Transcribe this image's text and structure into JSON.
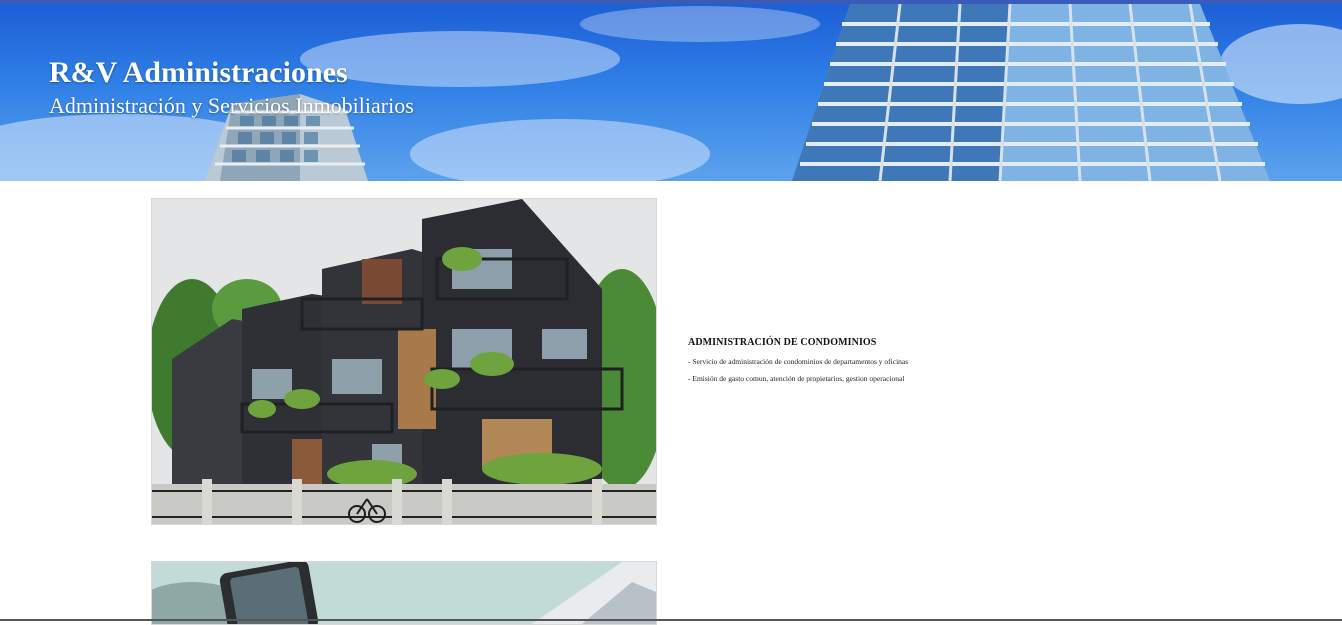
{
  "header": {
    "title": "R&V Administraciones",
    "subtitle": "Administración y Servicios Inmobiliarios"
  },
  "services": [
    {
      "heading": "ADMINISTRACIÓN DE CONDOMINIOS",
      "items": [
        "- Servicio de administración de condominios de departamentos y oficinas",
        "- Emisión de gasto comun, atención de propietarios, gestion operacional"
      ]
    }
  ],
  "colors": {
    "sky": "#2f7fe6",
    "text_on_hero": "#ffffff",
    "top_border": "#3a5bb8"
  }
}
